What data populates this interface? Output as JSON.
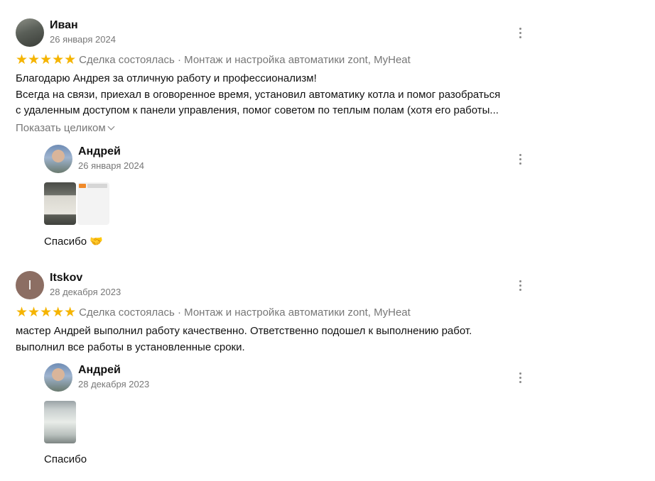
{
  "reviews": [
    {
      "author": "Иван",
      "date": "26 января 2024",
      "stars": "★★★★★",
      "meta": "Сделка состоялась · Монтаж и настройка автоматики zont, MyHeat",
      "text_lines": [
        "Благодарю Андрея за отличную работу и профессионализм!",
        "Всегда на связи, приехал в оговоренное время, установил автоматику котла и помог разобраться",
        "с удаленным доступом к панели управления, помог советом по теплым полам (хотя его работы..."
      ],
      "expand_label": "Показать целиком",
      "reply": {
        "author": "Андрей",
        "date": "26 января 2024",
        "photos": [
          "boiler-photo",
          "app-screenshot"
        ],
        "text": "Спасибо 🤝"
      }
    },
    {
      "author": "Itskov",
      "avatar_letter": "I",
      "date": "28 декабря 2023",
      "stars": "★★★★★",
      "meta": "Сделка состоялась · Монтаж и настройка автоматики zont, MyHeat",
      "text_lines": [
        "мастер Андрей выполнил работу качественно. Ответственно подошел к выполнению работ.",
        "выполнил все работы в установленные сроки."
      ],
      "reply": {
        "author": "Андрей",
        "date": "28 декабря 2023",
        "photos": [
          "cabinet-photo"
        ],
        "text": "Спасибо"
      }
    }
  ],
  "colors": {
    "stars": "#f5b400",
    "muted": "#777777",
    "letter_avatar": "#8c6e63"
  },
  "icons": {
    "more": "more-vertical-icon",
    "expand": "chevron-down-icon",
    "star": "star-icon"
  }
}
